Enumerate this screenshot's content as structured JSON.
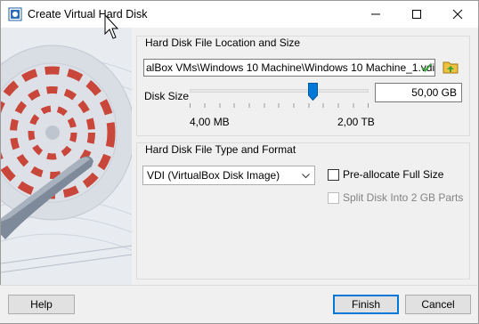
{
  "window": {
    "title": "Create Virtual Hard Disk",
    "controls": [
      "minimize-icon",
      "maximize-icon",
      "close-icon"
    ]
  },
  "location_group": {
    "title": "Hard Disk File Location and Size",
    "file_path": "alBox VMs\\Windows 10 Machine\\Windows 10 Machine_1.vdi",
    "folder_icon": "folder-icon"
  },
  "size": {
    "label": "Disk Size",
    "slider_fraction": 0.69,
    "min_label": "4,00 MB",
    "max_label": "2,00 TB",
    "value": "50,00 GB"
  },
  "format_group": {
    "title": "Hard Disk File Type and Format",
    "selected_type": "VDI (VirtualBox Disk Image)",
    "preallocate_label": "Pre-allocate Full Size",
    "preallocate_checked": false,
    "split_label": "Split Disk Into 2 GB Parts",
    "split_checked": false,
    "split_enabled": false
  },
  "buttons": {
    "help": "Help",
    "finish": "Finish",
    "cancel": "Cancel"
  },
  "colors": {
    "accent": "#0078d7",
    "disk_red": "#c9463a"
  }
}
